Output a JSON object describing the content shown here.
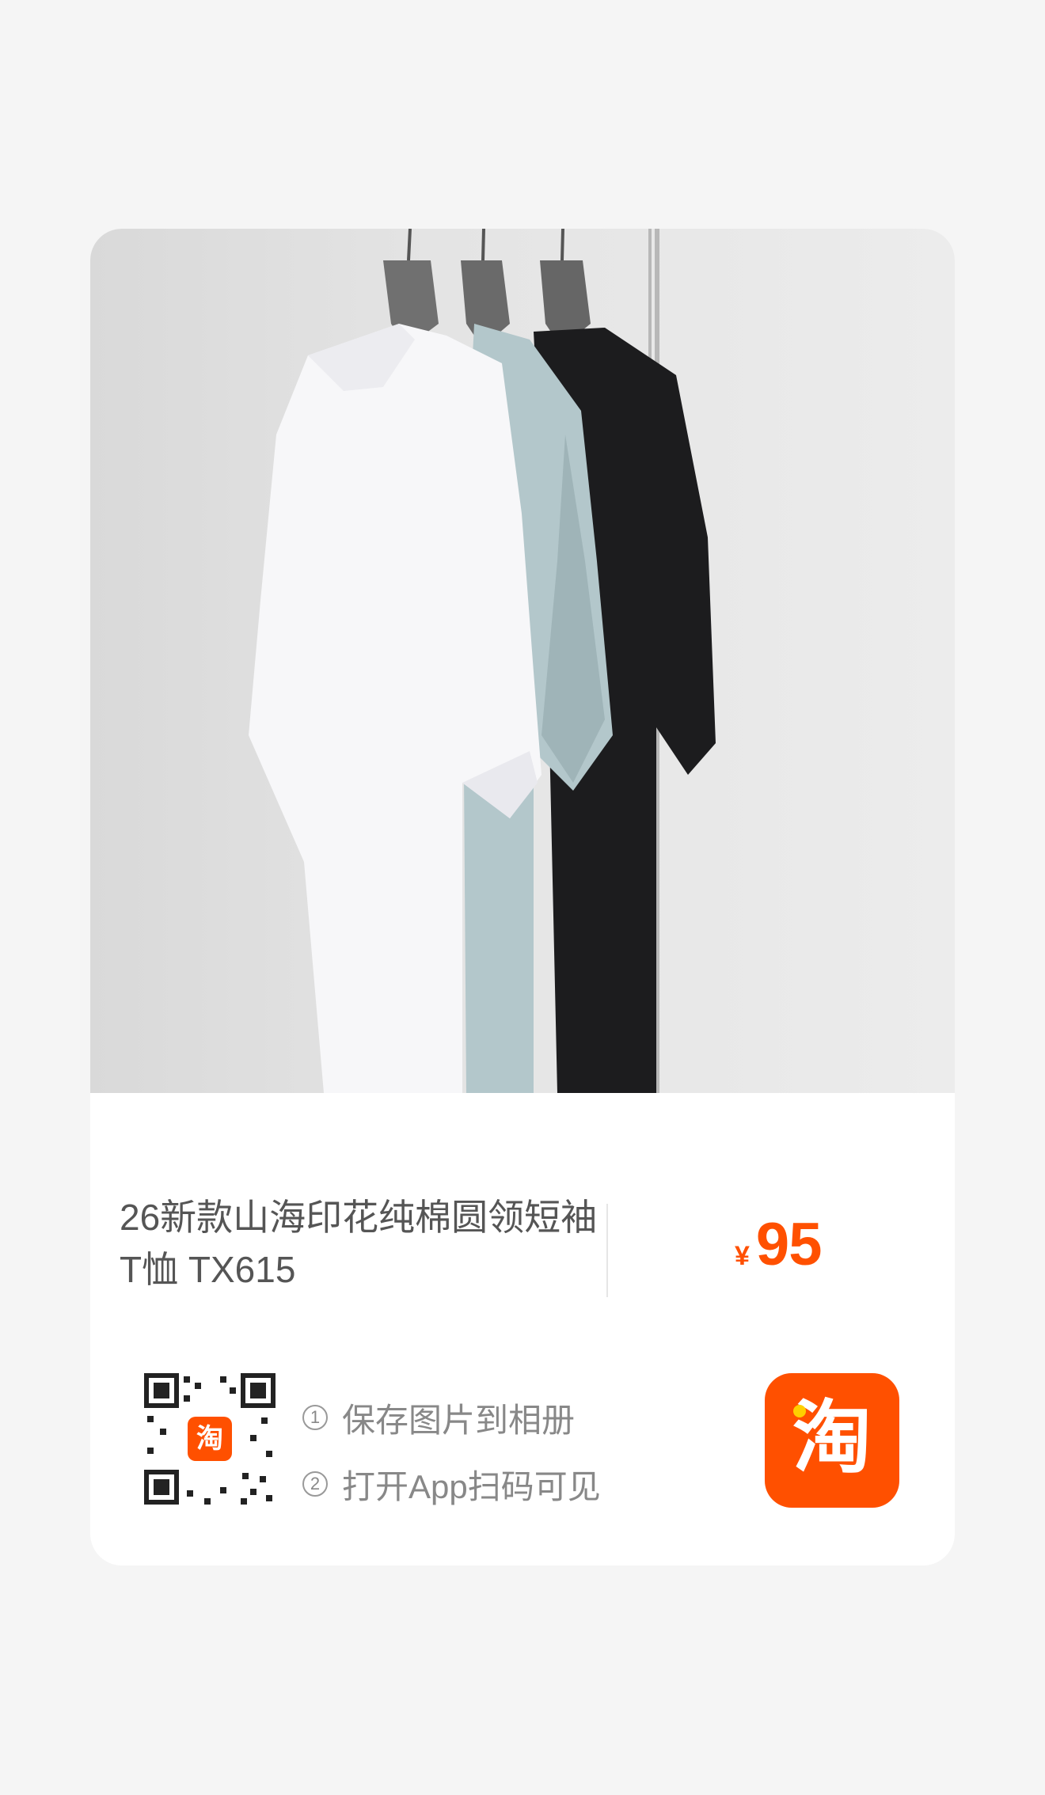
{
  "product": {
    "title": "26新款山海印花纯棉圆领短袖T恤 TX615",
    "currency_symbol": "¥",
    "price": "95"
  },
  "instructions": {
    "step1_marker": "1",
    "step1": "保存图片到相册",
    "step2_marker": "2",
    "step2": "打开App扫码可见"
  },
  "brand": {
    "logo_glyph": "淘",
    "accent_color": "#ff5000"
  },
  "icons": [
    "qr-code-icon",
    "taobao-logo-icon"
  ]
}
